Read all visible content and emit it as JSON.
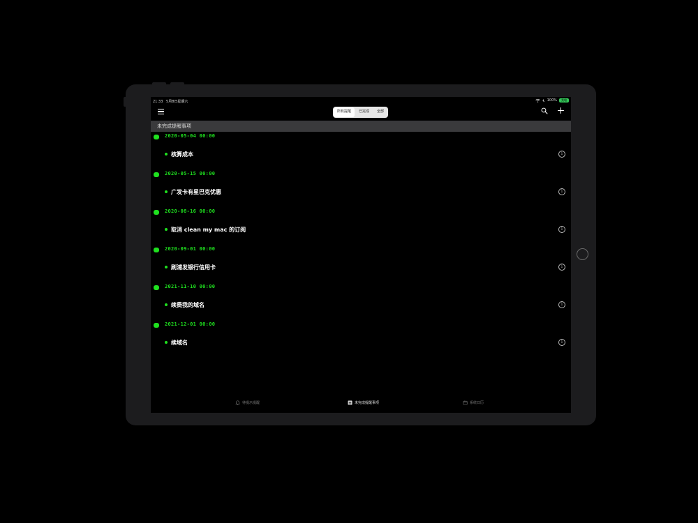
{
  "status_bar": {
    "time": "21:33",
    "date": "5月8日星期六",
    "battery": "100%",
    "battery_badge": "充电"
  },
  "nav": {
    "segments": [
      "所有提醒",
      "已完成",
      "全部"
    ],
    "active_segment": 0
  },
  "section": {
    "title": "未完成提醒事项"
  },
  "reminders": [
    {
      "date": "2020-05-04 00:00",
      "title": "核算成本"
    },
    {
      "date": "2020-05-15 00:00",
      "title": "广发卡有星巴克优惠"
    },
    {
      "date": "2020-08-16 00:00",
      "title": "取消 clean my mac 的订阅"
    },
    {
      "date": "2020-09-01 00:00",
      "title": "刷浦发银行信用卡"
    },
    {
      "date": "2021-11-10 00:00",
      "title": "续费我的域名"
    },
    {
      "date": "2021-12-01 00:00",
      "title": "续域名"
    }
  ],
  "tabs": [
    {
      "label": "待提示提醒",
      "icon": "bell-icon"
    },
    {
      "label": "未完成提醒事项",
      "icon": "list-icon"
    },
    {
      "label": "系统日历",
      "icon": "calendar-icon"
    }
  ],
  "active_tab": 1,
  "colors": {
    "accent": "#1fe01f",
    "background": "#000000",
    "section_header": "#3a3a3c",
    "device_bezel": "#1c1c1e"
  }
}
